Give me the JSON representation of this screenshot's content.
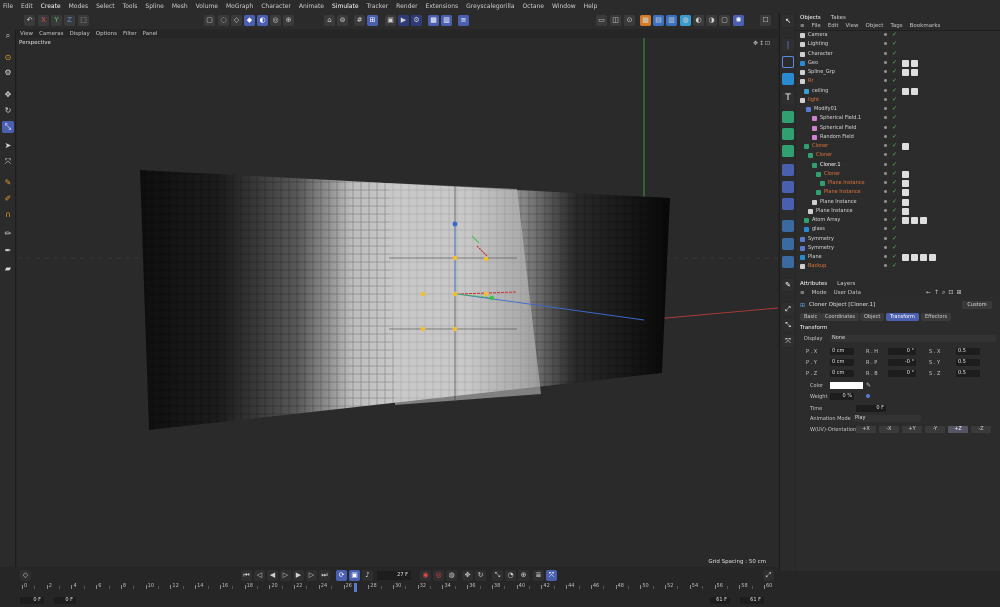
{
  "menu": [
    "File",
    "Edit",
    "Create",
    "Modes",
    "Select",
    "Tools",
    "Spline",
    "Mesh",
    "Volume",
    "MoGraph",
    "Character",
    "Animate",
    "Simulate",
    "Tracker",
    "Render",
    "Extensions",
    "Greyscalegorilla",
    "Octane",
    "Window",
    "Help"
  ],
  "viewport": {
    "menu": [
      "View",
      "Cameras",
      "Display",
      "Options",
      "Filter",
      "Panel"
    ],
    "label": "Perspective",
    "grid_spacing": "Grid Spacing : 50 cm"
  },
  "objects_panel": {
    "tabs": [
      "Objects",
      "Takes"
    ],
    "menu": [
      "File",
      "Edit",
      "View",
      "Object",
      "Tags",
      "Bookmarks"
    ],
    "items": [
      {
        "name": "Camera",
        "color": "#d9d9d9"
      },
      {
        "name": "Lighting",
        "color": "#d9d9d9"
      },
      {
        "name": "Character",
        "color": "#d9d9d9"
      },
      {
        "name": "Geo",
        "color": "#d9d9d9"
      },
      {
        "name": "Spline_Grp",
        "color": "#d9d9d9"
      },
      {
        "name": "Rr",
        "color": "#e0743a"
      },
      {
        "name": "ceiling",
        "color": "#d9d9d9"
      },
      {
        "name": "light",
        "color": "#e0743a"
      },
      {
        "name": "Modify01",
        "color": "#d9d9d9"
      },
      {
        "name": "Spherical Field.1",
        "color": "#d9d9d9"
      },
      {
        "name": "Spherical Field",
        "color": "#d9d9d9"
      },
      {
        "name": "Random Field",
        "color": "#d9d9d9"
      },
      {
        "name": "Cloner",
        "color": "#e0743a"
      },
      {
        "name": "Cloner",
        "color": "#e0743a"
      },
      {
        "name": "Cloner.1",
        "color": "#ffffff"
      },
      {
        "name": "Cloner",
        "color": "#e0743a"
      },
      {
        "name": "Plane Instance",
        "color": "#e0743a"
      },
      {
        "name": "Plane Instance",
        "color": "#e0743a"
      },
      {
        "name": "Plane Instance",
        "color": "#d9d9d9"
      },
      {
        "name": "Plane Instance",
        "color": "#d9d9d9"
      },
      {
        "name": "Atom Array",
        "color": "#d9d9d9"
      },
      {
        "name": "glass",
        "color": "#d9d9d9"
      },
      {
        "name": "Symmetry",
        "color": "#d9d9d9"
      },
      {
        "name": "Symmetry",
        "color": "#d9d9d9"
      },
      {
        "name": "Plane",
        "color": "#d9d9d9"
      },
      {
        "name": "Backup",
        "color": "#e0743a"
      }
    ]
  },
  "attributes": {
    "tabs": [
      "Attributes",
      "Layers"
    ],
    "menu": [
      "Mode",
      "User Data"
    ],
    "object_title": "Cloner Object [Cloner.1]",
    "custom": "Custom",
    "subtabs": [
      "Basic",
      "Coordinates",
      "Object",
      "Transform",
      "Effectors"
    ],
    "section": "Transform",
    "display_label": "Display",
    "display_value": "None",
    "rows": [
      {
        "pl": "P . X",
        "pv": "0 cm",
        "rl": "R . H",
        "rv": "0 °",
        "sl": "S . X",
        "sv": "0.5"
      },
      {
        "pl": "P . Y",
        "pv": "0 cm",
        "rl": "R . P",
        "rv": "-0 °",
        "sl": "S . Y",
        "sv": "0.5"
      },
      {
        "pl": "P . Z",
        "pv": "0 cm",
        "rl": "R . B",
        "rv": "0 °",
        "sl": "S . Z",
        "sv": "0.5"
      }
    ],
    "color_label": "Color",
    "weight_label": "Weight",
    "weight_value": "0 %",
    "time_label": "Time",
    "time_value": "0 F",
    "anim_label": "Animation Mode",
    "anim_value": "Play",
    "orient_label": "W(UV)-Orientation",
    "orient_buttons": [
      "+X",
      "-X",
      "+Y",
      "-Y",
      "+Z",
      "-Z"
    ]
  },
  "timeline": {
    "current_frame": "27 F",
    "ticks": [
      "0",
      "2",
      "4",
      "6",
      "8",
      "10",
      "12",
      "14",
      "16",
      "18",
      "20",
      "22",
      "24",
      "26",
      "28",
      "30",
      "32",
      "34",
      "36",
      "38",
      "40",
      "42",
      "44",
      "46",
      "48",
      "50",
      "52",
      "54",
      "56",
      "58",
      "60"
    ],
    "start_a": "0 F",
    "start_b": "0 F",
    "end_a": "61 F",
    "end_b": "61 F"
  },
  "colors": {
    "accent": "#4a5fb0",
    "orange": "#e0743a",
    "check": "#58c25a"
  }
}
